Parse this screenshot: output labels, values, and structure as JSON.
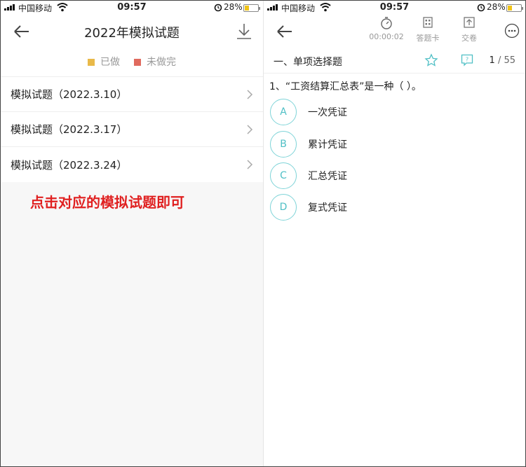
{
  "left": {
    "status": {
      "carrier": "中国移动",
      "time": "09:57",
      "battery": "28%"
    },
    "nav": {
      "title": "2022年模拟试题"
    },
    "legend": [
      {
        "label": "已做",
        "color": "#e9b949"
      },
      {
        "label": "未做完",
        "color": "#e06a5e"
      }
    ],
    "list": [
      {
        "label": "模拟试题（2022.3.10）"
      },
      {
        "label": "模拟试题（2022.3.17）"
      },
      {
        "label": "模拟试题（2022.3.24）"
      }
    ],
    "annotation": "点击对应的模拟试题即可"
  },
  "right": {
    "status": {
      "carrier": "中国移动",
      "time": "09:57",
      "battery": "28%"
    },
    "nav": {
      "timer": "00:00:02",
      "answer_card": "答题卡",
      "submit": "交卷"
    },
    "section": "一、单项选择题",
    "progress": {
      "current": "1",
      "total": "/ 55"
    },
    "question": "1、“工资结算汇总表”是一种（    ）。",
    "options": [
      {
        "key": "A",
        "text": "一次凭证"
      },
      {
        "key": "B",
        "text": "累计凭证"
      },
      {
        "key": "C",
        "text": "汇总凭证"
      },
      {
        "key": "D",
        "text": "复式凭证"
      }
    ]
  },
  "colors": {
    "accent": "#4fbfc5",
    "annotation": "#e02020"
  }
}
